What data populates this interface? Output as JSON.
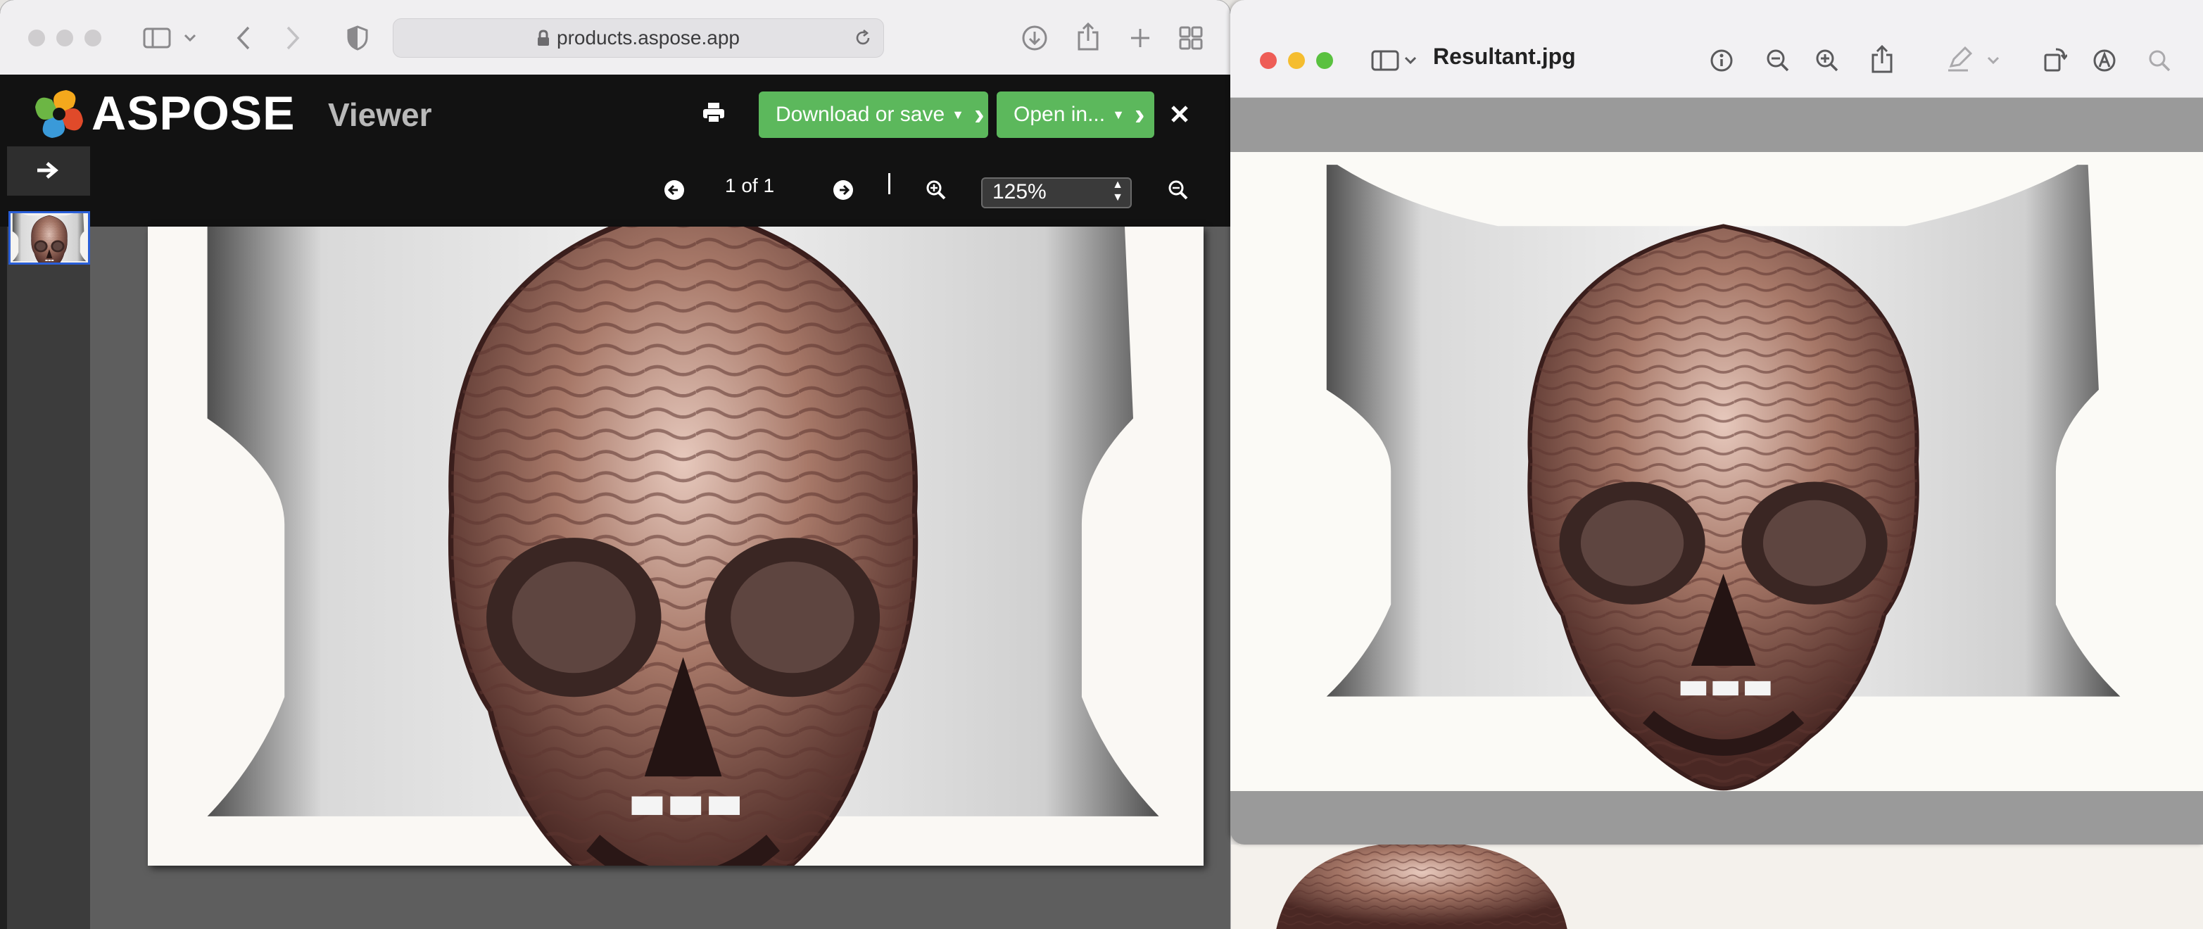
{
  "safari": {
    "url": "products.aspose.app"
  },
  "aspose": {
    "brand": "ASPOSE",
    "app_name": "Viewer",
    "download_label": "Download or save",
    "open_label": "Open in...",
    "page_indicator": "1 of 1",
    "zoom_value": "125%",
    "accent_green": "#5cb85c"
  },
  "preview": {
    "title": "Resultant.jpg"
  },
  "icons": [
    "sidebar-icon",
    "chevron-left-icon",
    "chevron-right-icon",
    "shield-icon",
    "lock-icon",
    "reload-icon",
    "download-icon",
    "share-icon",
    "plus-icon",
    "tabs-grid-icon",
    "print-icon",
    "close-icon",
    "arrow-right-icon",
    "arrow-left-circle-icon",
    "arrow-right-circle-icon",
    "zoom-in-icon",
    "zoom-out-icon",
    "info-icon",
    "rotate-icon",
    "markup-icon",
    "search-icon",
    "highlighter-icon"
  ]
}
